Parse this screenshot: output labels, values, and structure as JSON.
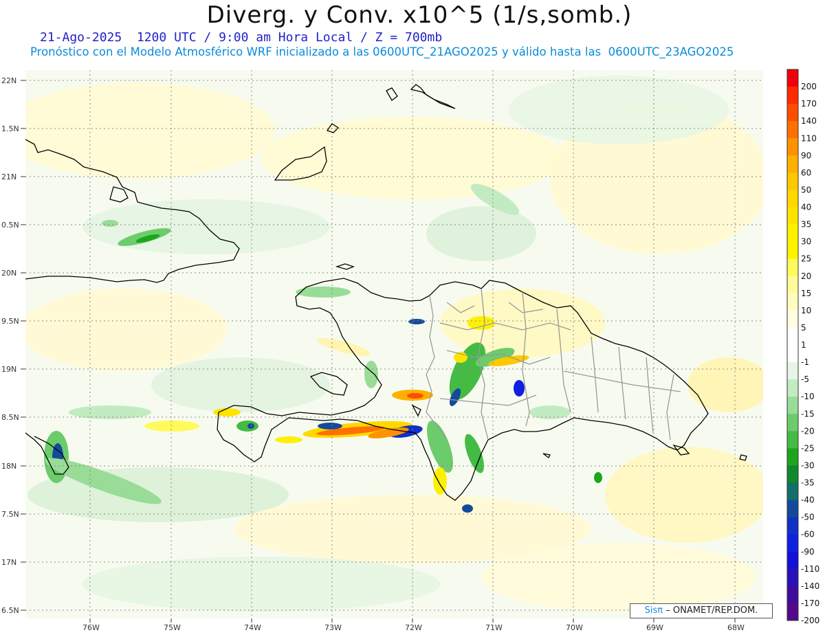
{
  "header": {
    "title": "Diverg. y Conv. x10^5 (1/s,somb.)",
    "subtitle_date": "21-Ago-2025  1200 UTC / 9:00 am Hora Local / Z = 700mb",
    "subtitle_model": "Pronóstico con el Modelo Atmosférico WRF inicializado a las 0600UTC_21AGO2025 y válido hasta las  0600UTC_23AGO2025"
  },
  "axes": {
    "lat_labels": [
      "22N",
      "1.5N",
      "21N",
      "0.5N",
      "20N",
      "9.5N",
      "19N",
      "8.5N",
      "18N",
      "7.5N",
      "17N",
      "6.5N"
    ],
    "lon_labels": [
      "76W",
      "75W",
      "74W",
      "73W",
      "72W",
      "71W",
      "70W",
      "69W",
      "68W"
    ]
  },
  "colorbar": {
    "labels": [
      "200",
      "170",
      "140",
      "110",
      "90",
      "60",
      "50",
      "40",
      "35",
      "30",
      "25",
      "20",
      "15",
      "10",
      "5",
      "1",
      "-1",
      "-5",
      "-10",
      "-15",
      "-20",
      "-25",
      "-30",
      "-35",
      "-40",
      "-50",
      "-60",
      "-90",
      "-110",
      "-140",
      "-170",
      "-200"
    ],
    "colors": [
      "#f00008",
      "#ff2a00",
      "#ff4d00",
      "#ff7000",
      "#ff9200",
      "#ffb000",
      "#ffc800",
      "#ffd800",
      "#ffe400",
      "#fff000",
      "#fff400",
      "#fffa5a",
      "#fffc96",
      "#fffdbe",
      "#fffee0",
      "#ffffff",
      "#ffffff",
      "#e6f5e6",
      "#c2ebc2",
      "#98dc98",
      "#6ccc6c",
      "#44bb44",
      "#1ea51e",
      "#0e8a2a",
      "#126f6a",
      "#144a9a",
      "#1030c8",
      "#1020e0",
      "#1410d8",
      "#2a10b8",
      "#400c9c",
      "#55088a"
    ]
  },
  "credit": {
    "logo": "Sisπ",
    "text": "– ONAMET/REP.DOM."
  }
}
